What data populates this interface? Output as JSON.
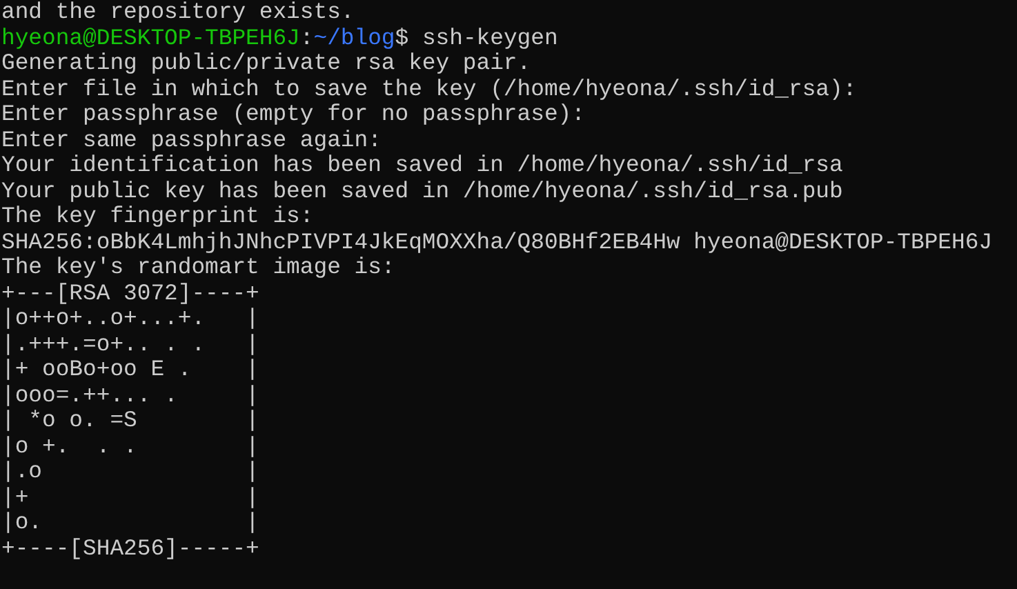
{
  "terminal": {
    "previous_output": [
      "and the repository exists."
    ],
    "prompt": {
      "user_host": "hyeona@DESKTOP-TBPEH6J",
      "separator": ":",
      "path": "~/blog",
      "command": "$ ssh-keygen"
    },
    "output": [
      "Generating public/private rsa key pair.",
      "Enter file in which to save the key (/home/hyeona/.ssh/id_rsa):",
      "Enter passphrase (empty for no passphrase):",
      "Enter same passphrase again:",
      "Your identification has been saved in /home/hyeona/.ssh/id_rsa",
      "Your public key has been saved in /home/hyeona/.ssh/id_rsa.pub",
      "The key fingerprint is:",
      "SHA256:oBbK4LmhjhJNhcPIVPI4JkEqMOXXha/Q80BHf2EB4Hw hyeona@DESKTOP-TBPEH6J",
      "The key's randomart image is:",
      "+---[RSA 3072]----+",
      "|o++o+..o+...+.   |",
      "|.+++.=o+.. . .   |",
      "|+ ooBo+oo E .    |",
      "|ooo=.++... .     |",
      "| *o o. =S        |",
      "|o +.  . .        |",
      "|.o               |",
      "|+                |",
      "|o.               |",
      "+----[SHA256]-----+"
    ]
  }
}
